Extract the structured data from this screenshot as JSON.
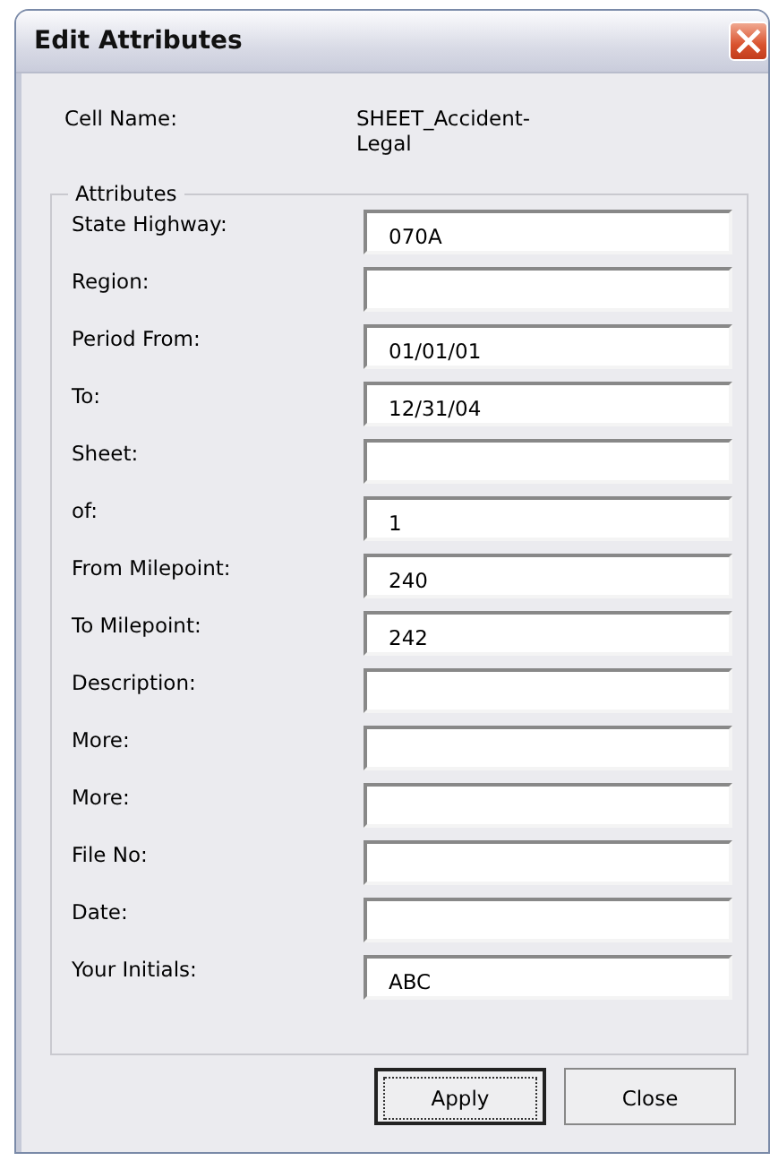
{
  "window": {
    "title": "Edit Attributes"
  },
  "cell_name": {
    "label": "Cell Name:",
    "value": "SHEET_Accident-Legal"
  },
  "attributes": {
    "legend": "Attributes",
    "fields": [
      {
        "label": "State Highway:",
        "value": "070A"
      },
      {
        "label": "Region:"
      },
      {
        "label": "Period From:",
        "value": "01/01/01"
      },
      {
        "label": "To:",
        "value": "12/31/04"
      },
      {
        "label": "Sheet:"
      },
      {
        "label": "of:",
        "value": "1"
      },
      {
        "label": "From Milepoint:",
        "value": "240"
      },
      {
        "label": "To Milepoint:",
        "value": "242"
      },
      {
        "label": "Description:"
      },
      {
        "label": "More:"
      },
      {
        "label": "More:"
      },
      {
        "label": "File No:"
      },
      {
        "label": "Date:"
      },
      {
        "label": "Your Initials:",
        "value": "ABC"
      }
    ]
  },
  "buttons": [
    {
      "label": "Apply",
      "default": true
    },
    {
      "label": "Close",
      "default": false
    }
  ]
}
